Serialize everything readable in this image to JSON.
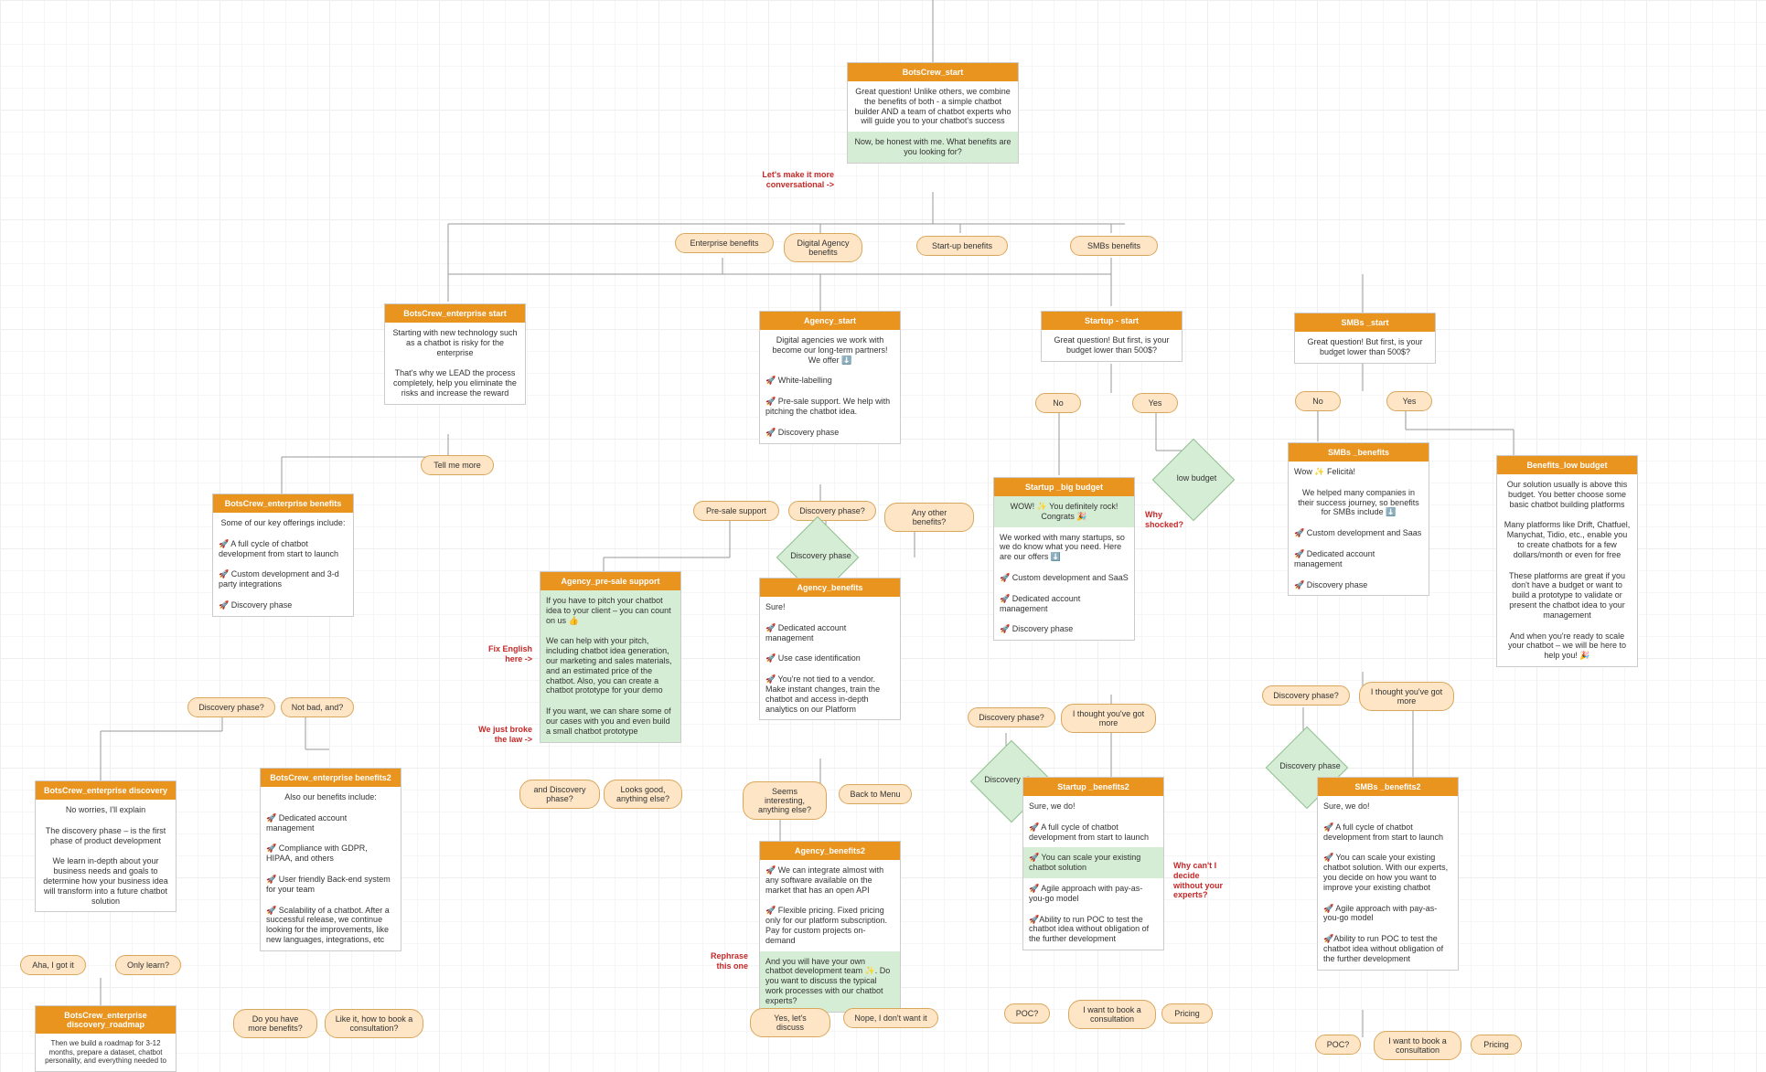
{
  "start": {
    "hdr": "BotsCrew_start",
    "a": "Great question! Unlike others, we combine the benefits of both - a simple chatbot builder AND a team of chatbot experts who will guide you to your chatbot's success",
    "b": "Now, be honest with me. What benefits are you looking for?"
  },
  "ann": {
    "conv": "Let's make it more conversational ->",
    "fix": "Fix English here ->",
    "broke": "We just broke the law ->",
    "why": "Why shocked?",
    "cant": "Why can't I decide without your experts?",
    "reph": "Rephrase this one"
  },
  "opts": {
    "ent": "Enterprise benefits",
    "ag": "Digital Agency benefits",
    "su": "Start-up benefits",
    "smb": "SMBs benefits"
  },
  "ent": {
    "hdr": "BotsCrew_enterprise start",
    "a": "Starting with new technology such as a chatbot is risky for the enterprise",
    "b": "That's why we LEAD the process completely, help you eliminate the risks and increase the reward",
    "tell": "Tell me more"
  },
  "entb": {
    "hdr": "BotsCrew_enterprise benefits",
    "a": "Some of our key offerings include:",
    "b": "🚀 A full cycle of chatbot development from start to launch",
    "c": "🚀 Custom development and 3-d party integrations",
    "d": "🚀 Discovery phase",
    "q1": "Discovery phase?",
    "q2": "Not bad, and?"
  },
  "entd": {
    "hdr": "BotsCrew_enterprise discovery",
    "a": "No worries, I'll explain",
    "b": "The discovery phase – is the first phase of product development",
    "c": "We learn in-depth about your business needs and goals to determine how your business idea will transform into a future chatbot solution",
    "q1": "Aha, I got it",
    "q2": "Only learn?"
  },
  "entr": {
    "hdr": "BotsCrew_enterprise discovery_roadmap",
    "a": "Then we build a roadmap for 3-12 months, prepare a dataset, chatbot personality, and everything needed to"
  },
  "entb2": {
    "hdr": "BotsCrew_enterprise benefits2",
    "a": "Also our benefits include:",
    "b": "🚀 Dedicated account management",
    "c": "🚀 Compliance with GDPR, HIPAA, and others",
    "d": "🚀 User friendly Back-end system for your team",
    "e": "🚀 Scalability of a chatbot. After a successful release, we continue looking for the improvements, like new languages, integrations, etc",
    "q1": "Do you have more benefits?",
    "q2": "Like it, how to book a consultation?"
  },
  "ag": {
    "hdr": "Agency_start",
    "a": "Digital agencies we work with become our long-term partners! We offer ⬇️",
    "b": "🚀 White-labelling",
    "c": "🚀 Pre-sale support. We help with pitching the chatbot idea.",
    "d": "🚀 Discovery phase",
    "q1": "Pre-sale support",
    "q2": "Discovery phase?",
    "q3": "Any other benefits?",
    "dia": "Discovery phase"
  },
  "agps": {
    "hdr": "Agency_pre-sale support",
    "a": "If you have to pitch your chatbot idea to your client – you can count on us 👍",
    "b": "We can help with your pitch, including chatbot idea generation, our marketing and sales materials, and an estimated price of the chatbot. Also, you can create a chatbot prototype for your demo",
    "c": "If you want, we can share some of our cases with you and even build a small chatbot prototype",
    "q1": "and Discovery phase?",
    "q2": "Looks good, anything else?"
  },
  "agb": {
    "hdr": "Agency_benefits",
    "a": "Sure!",
    "b": "🚀 Dedicated account management",
    "c": "🚀 Use case identification",
    "d": "🚀 You're not tied to a vendor. Make instant changes, train the chatbot and access in-depth analytics on our Platform",
    "q1": "Seems interesting, anything else?",
    "q2": "Back to Menu"
  },
  "agb2": {
    "hdr": "Agency_benefits2",
    "a": "🚀 We can integrate almost with any software available on the market that has an open API",
    "b": "🚀 Flexible pricing. Fixed pricing only for our platform subscription. Pay for custom projects on-demand",
    "c": "And you will have your own chatbot development team ✨. Do you want to discuss the typical work processes with our chatbot experts?",
    "q1": "Yes, let's discuss",
    "q2": "Nope, I don't want it"
  },
  "su": {
    "hdr": "Startup - start",
    "a": "Great question! But first, is your budget lower than 500$?",
    "no": "No",
    "yes": "Yes",
    "dia": "low budget"
  },
  "sub": {
    "hdr": "Startup _big budget",
    "a": "WOW! ✨ You definitely rock! Congrats 🎉",
    "b": "We worked with many startups, so we do know what you need. Here are our offers ⬇️",
    "c": "🚀 Custom development and SaaS",
    "d": "🚀 Dedicated account management",
    "e": "🚀 Discovery phase",
    "q1": "Discovery phase?",
    "q2": "I thought you've got more",
    "dia": "Discovery phase"
  },
  "sub2": {
    "hdr": "Startup _benefits2",
    "a": "Sure, we do!",
    "b": "🚀 A full cycle of chatbot development from start to launch",
    "c": "🚀 You can scale your existing chatbot solution",
    "d": "🚀 Agile approach with pay-as-you-go model",
    "e": "🚀Ability to run POC to test the chatbot idea without obligation of the further development",
    "q1": "POC?",
    "q2": "I want to book a consultation",
    "q3": "Pricing"
  },
  "smb": {
    "hdr": "SMBs _start",
    "a": "Great question! But first, is your budget lower than 500$?",
    "no": "No",
    "yes": "Yes"
  },
  "smbb": {
    "hdr": "SMBs _benefits",
    "a": "Wow ✨ Felicità!",
    "b": "We helped many companies in their success journey, so benefits for SMBs include ⬇️",
    "c": "🚀 Custom development and Saas",
    "d": "🚀 Dedicated account management",
    "e": "🚀 Discovery phase",
    "q1": "Discovery phase?",
    "q2": "I thought you've got more",
    "dia": "Discovery phase"
  },
  "smbb2": {
    "hdr": "SMBs _benefits2",
    "a": "Sure, we do!",
    "b": "🚀 A full cycle of chatbot development from start to launch",
    "c": "🚀 You can scale your existing chatbot solution. With our experts, you decide on how you want to improve your existing chatbot",
    "d": "🚀 Agile approach with pay-as-you-go model",
    "e": "🚀Ability to run POC to test the chatbot idea without obligation of the further development",
    "q1": "POC?",
    "q2": "I want to book a consultation",
    "q3": "Pricing"
  },
  "low": {
    "hdr": "Benefits_low budget",
    "a": "Our solution usually is above this budget. You better choose some basic chatbot building platforms",
    "b": "Many platforms like Drift, Chatfuel, Manychat, Tidio, etc., enable you to create chatbots for a few dollars/month or even for free",
    "c": "These platforms are great if you don't have a budget or want to build a prototype to validate or present the chatbot idea to your management",
    "d": "And when you're ready to scale your chatbot – we will be here to help you! 🎉"
  }
}
